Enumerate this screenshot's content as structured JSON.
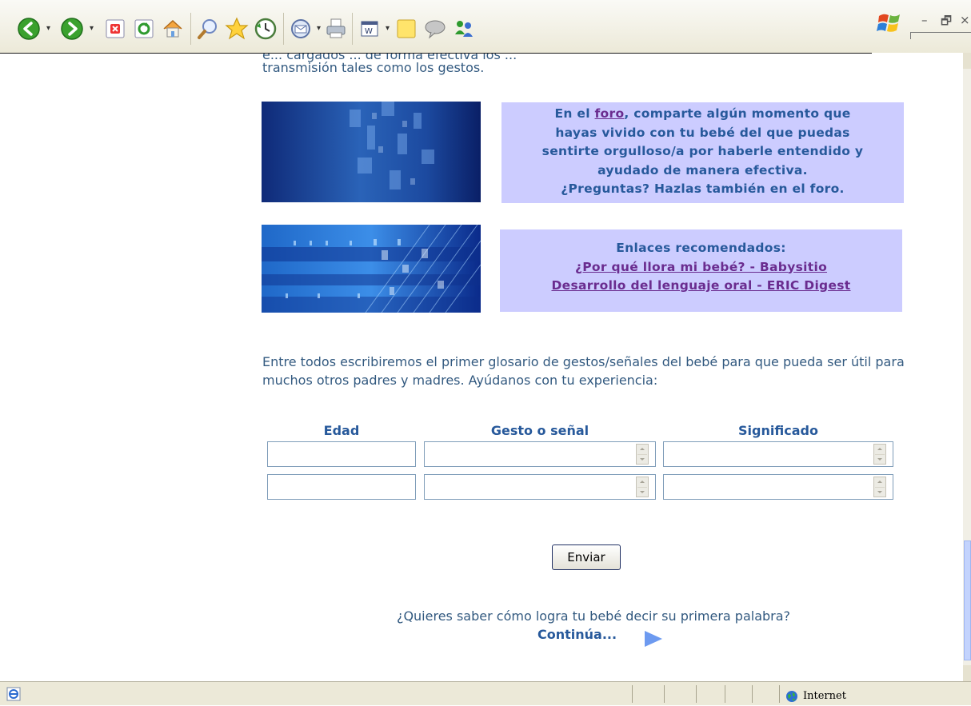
{
  "toolbar": {
    "buttons": [
      "back-icon",
      "forward-icon",
      "stop-icon",
      "refresh-icon",
      "home-icon",
      "search-icon",
      "favorites-icon",
      "history-icon",
      "mail-icon",
      "print-icon",
      "edit-icon",
      "notes-icon",
      "discuss-icon",
      "messenger-icon"
    ],
    "window_controls": {
      "minimize": "–",
      "restore": "🗗",
      "close": "×"
    }
  },
  "page": {
    "cut_text": "e... cargados ... de forma efectiva los ...",
    "intro_tail": "transmisión tales como los gestos.",
    "forum_box": {
      "prefix": "En el ",
      "link": "foro",
      "line1_rest": ", comparte algún momento que",
      "line2": "hayas vivido con tu bebé del que puedas",
      "line3": "sentirte orgulloso/a por haberle entendido y",
      "line4": "ayudado de manera efectiva.",
      "line5": "¿Preguntas? Hazlas también en el foro."
    },
    "links_box": {
      "title": "Enlaces recomendados:",
      "links": [
        "¿Por qué llora mi bebé? - Babysitio",
        "Desarrollo del lenguaje oral - ERIC Digest"
      ]
    },
    "glossary_text": "Entre todos escribiremos el primer glosario de gestos/señales del bebé para que pueda ser útil para muchos otros padres y madres.  Ayúdanos con tu experiencia:",
    "form": {
      "headers": [
        "Edad",
        "Gesto o señal",
        "Significado"
      ],
      "rows": [
        {
          "edad": "",
          "gesto": "",
          "significado": ""
        },
        {
          "edad": "",
          "gesto": "",
          "significado": ""
        }
      ],
      "submit_label": "Enviar"
    },
    "question": "¿Quieres saber cómo logra tu bebé decir su primera palabra?",
    "continue_label": "Continúa..."
  },
  "status": {
    "zone": "Internet"
  },
  "colors": {
    "text": "#335a80",
    "heading": "#27599b",
    "box_bg": "#ccccff",
    "link_visited": "#6a2c8f",
    "arrow": "#6d9af0"
  }
}
